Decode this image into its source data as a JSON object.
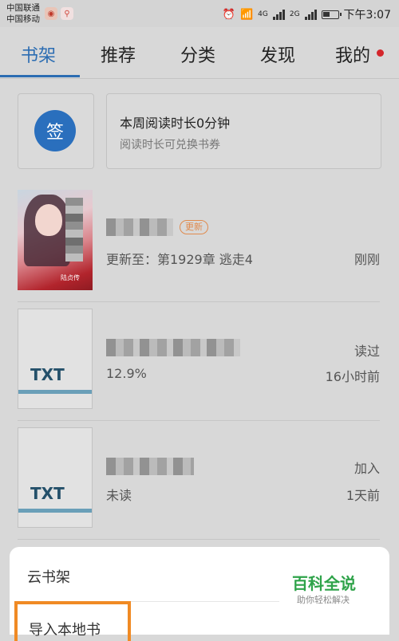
{
  "status_bar": {
    "carrier1": "中国联通",
    "carrier2": "中国移动",
    "network1": "4G",
    "network2": "2G",
    "time": "下午3:07"
  },
  "tabs": [
    {
      "label": "书架",
      "active": true
    },
    {
      "label": "推荐",
      "active": false
    },
    {
      "label": "分类",
      "active": false
    },
    {
      "label": "发现",
      "active": false
    },
    {
      "label": "我的",
      "active": false
    }
  ],
  "sign_in": {
    "label": "签"
  },
  "reading": {
    "title": "本周阅读时长0分钟",
    "subtitle": "阅读时长可兑换书券"
  },
  "books": [
    {
      "badge": "更新",
      "detail": "更新至：第1929章 逃走4",
      "status": "刚刚",
      "cover_caption": "陆贞传"
    },
    {
      "cover_label": "TXT",
      "status": "读过",
      "progress": "12.9%",
      "time": "16小时前"
    },
    {
      "cover_label": "TXT",
      "status": "加入",
      "progress": "未读",
      "time": "1天前"
    }
  ],
  "sheet": {
    "item1": "云书架",
    "item2": "导入本地书"
  },
  "watermark": {
    "title": "百科全说",
    "subtitle": "助你轻松解决"
  },
  "colors": {
    "accent": "#2c6db2",
    "badge": "#e08a4d",
    "highlight": "#f08a24",
    "watermark": "#2fa34a"
  }
}
